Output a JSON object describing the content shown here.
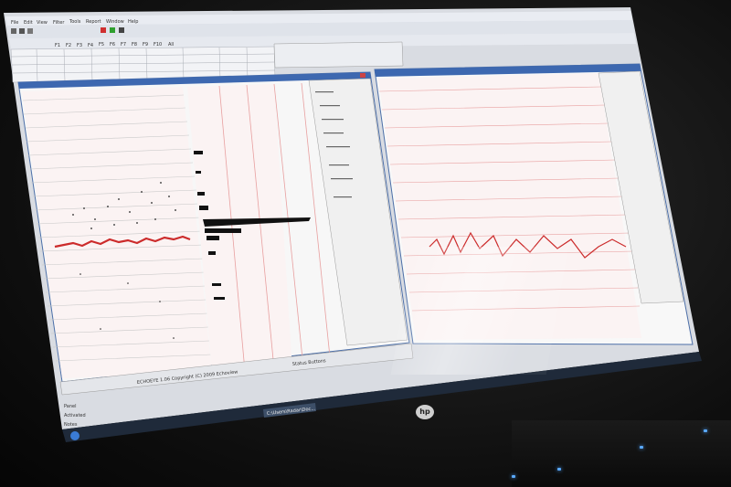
{
  "menu_items": [
    "File",
    "Edit",
    "View",
    "Filter",
    "Tools",
    "Report",
    "Window",
    "Help"
  ],
  "fkeys": [
    "F1",
    "F2",
    "F3",
    "F4",
    "F5",
    "F6",
    "F7",
    "F8",
    "F9",
    "F10",
    "All"
  ],
  "footer": {
    "label1": "Panel",
    "label2": "Activated",
    "label3": "Notes",
    "copyright": "ECHOEYE 1.06 Copyright (C) 2009 Echoview",
    "status_label": "Status Buttons"
  },
  "taskbar": {
    "start": "Start",
    "task_item": "C:\\Users\\Radar\\Doc..."
  },
  "brand": "hp",
  "colors": {
    "trace_red": "#cc2b2b",
    "grid_red": "#e8a0a0",
    "panel_bg": "#f4f4f4",
    "window_title": "#2a5aa0"
  }
}
